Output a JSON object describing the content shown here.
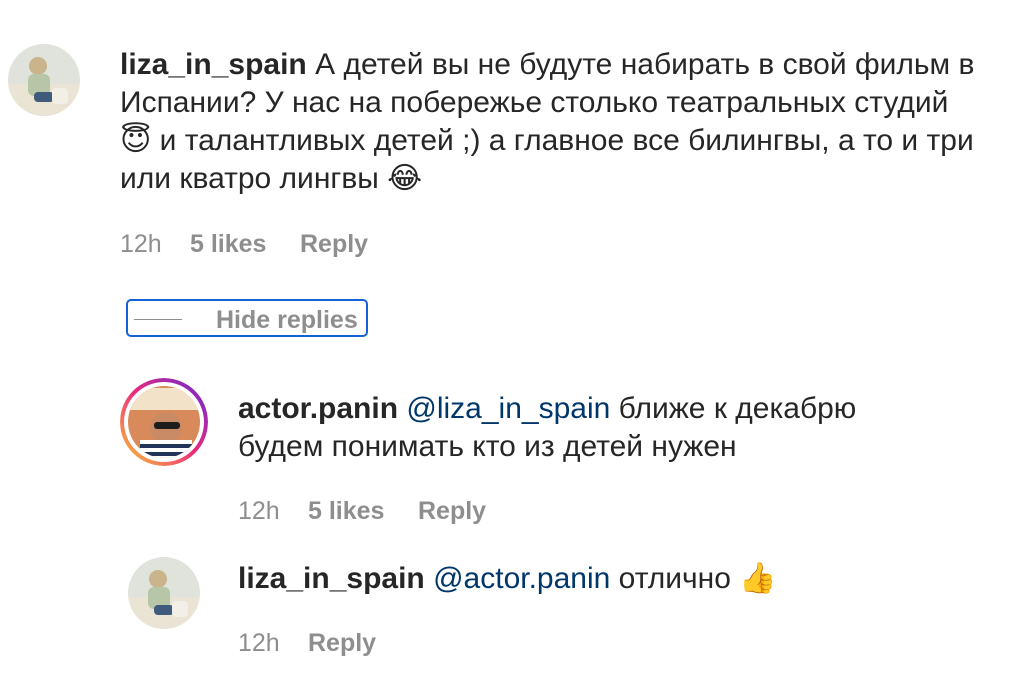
{
  "comments": [
    {
      "username": "liza_in_spain",
      "text": "А детей вы не будуте набирать в свой фильм в Испании? У нас на побережье столько театральных студий",
      "emoji_1": "😇",
      "text_2": "и талантливых детей ;) а главное все билингвы, а то и три или кватро лингвы",
      "emoji_2": "😂",
      "time": "12h",
      "likes": "5 likes",
      "reply": "Reply"
    }
  ],
  "hide_replies": "Hide replies",
  "replies": [
    {
      "username": "actor.panin",
      "mention": "@liza_in_spain",
      "text": "ближе к декабрю будем понимать кто из детей нужен",
      "time": "12h",
      "likes": "5 likes",
      "reply": "Reply"
    },
    {
      "username": "liza_in_spain",
      "mention": "@actor.panin",
      "text": "отлично",
      "emoji": "👍",
      "time": "12h",
      "reply": "Reply"
    }
  ],
  "colors": {
    "text": "#262626",
    "meta": "#8e8e8e",
    "mention": "#00376b",
    "focus_outline": "#1463d6",
    "story_ring_start": "#f9ce34",
    "story_ring_mid": "#ee2a7b",
    "story_ring_end": "#6228d7"
  }
}
